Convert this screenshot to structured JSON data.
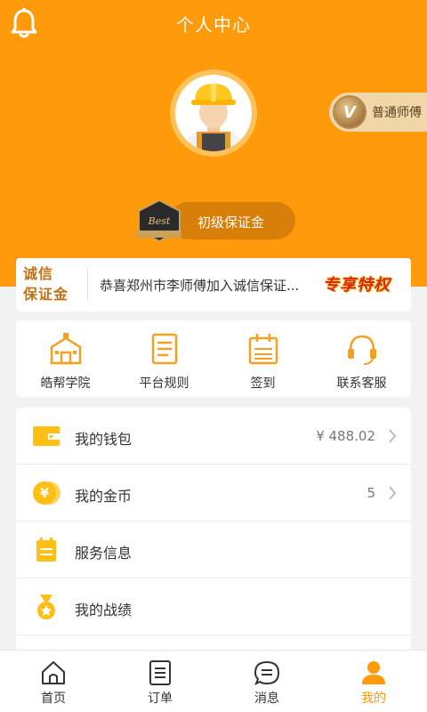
{
  "header": {
    "title": "个人中心"
  },
  "profile": {
    "level_label": "普通师傅",
    "level_icon": "v-medal-icon",
    "deposit_label": "初级保证金"
  },
  "notice": {
    "logo_line1": "诚信",
    "logo_line2": "保证金",
    "text": "恭喜郑州市李师傅加入诚信保证...",
    "promo": "专享特权"
  },
  "quick_actions": [
    {
      "label": "皓帮学院",
      "icon": "school-icon"
    },
    {
      "label": "平台规则",
      "icon": "rules-icon"
    },
    {
      "label": "签到",
      "icon": "calendar-icon"
    },
    {
      "label": "联系客服",
      "icon": "headset-icon"
    }
  ],
  "menu": [
    {
      "label": "我的钱包",
      "value": "¥ 488.02",
      "icon": "wallet-icon"
    },
    {
      "label": "我的金币",
      "value": "5",
      "icon": "coin-icon"
    },
    {
      "label": "服务信息",
      "value": "",
      "icon": "service-info-icon"
    },
    {
      "label": "我的战绩",
      "value": "",
      "icon": "medal-icon"
    }
  ],
  "tabs": [
    {
      "label": "首页",
      "icon": "home-icon"
    },
    {
      "label": "订单",
      "icon": "order-icon"
    },
    {
      "label": "消息",
      "icon": "message-icon"
    },
    {
      "label": "我的",
      "icon": "profile-icon",
      "active": true
    }
  ],
  "colors": {
    "accent": "#ff9a0a",
    "promo": "#d8261b"
  }
}
